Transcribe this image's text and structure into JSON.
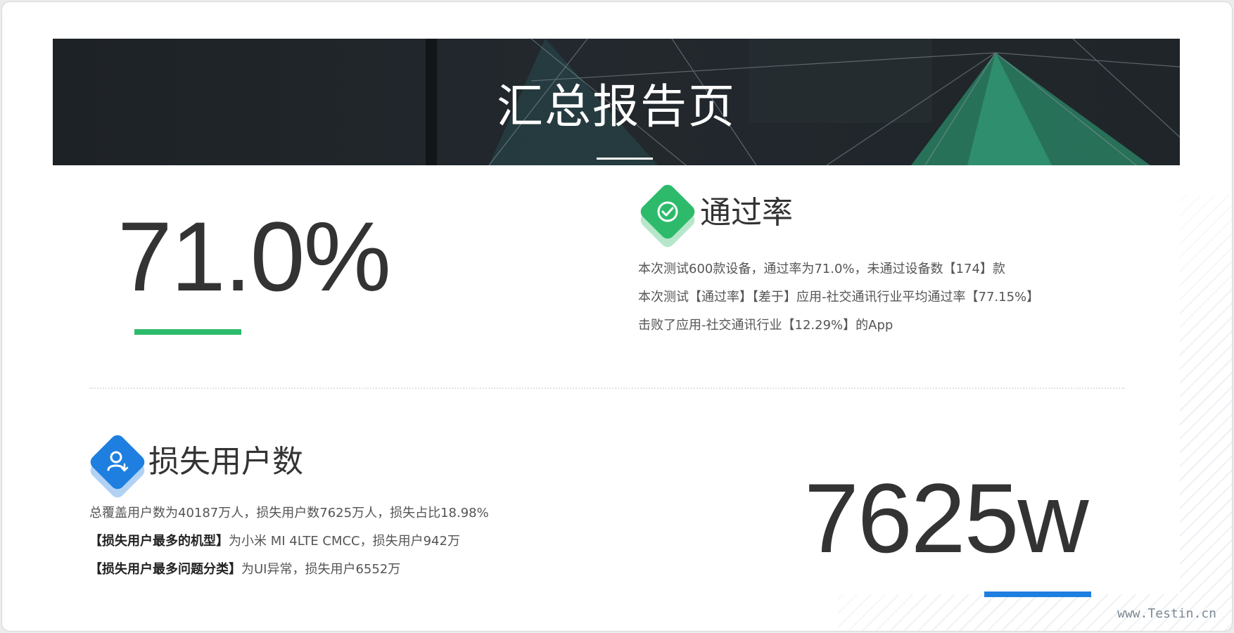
{
  "banner": {
    "title": "汇总报告页"
  },
  "pass_rate": {
    "value": "71.0%",
    "title": "通过率",
    "line1": "本次测试600款设备，通过率为71.0%，未通过设备数【174】款",
    "line2": "本次测试【通过率】【差于】应用-社交通讯行业平均通过率【77.15%】",
    "line3": "击败了应用-社交通讯行业【12.29%】的App",
    "accent_color": "#2dbb6b"
  },
  "lost_users": {
    "value": "7625w",
    "title": "损失用户数",
    "line1": "总覆盖用户数为40187万人，损失用户数7625万人，损失占比18.98%",
    "line2_label": "【损失用户最多的机型】",
    "line2_text": "为小米 MI 4LTE CMCC，损失用户942万",
    "line3_label": "【损失用户最多问题分类】",
    "line3_text": "为UI异常，损失用户6552万",
    "accent_color": "#1f7fe0"
  },
  "watermark": "www.Testin.cn",
  "icons": {
    "pass_rate": "check-circle-icon",
    "lost_users": "user-download-icon"
  }
}
